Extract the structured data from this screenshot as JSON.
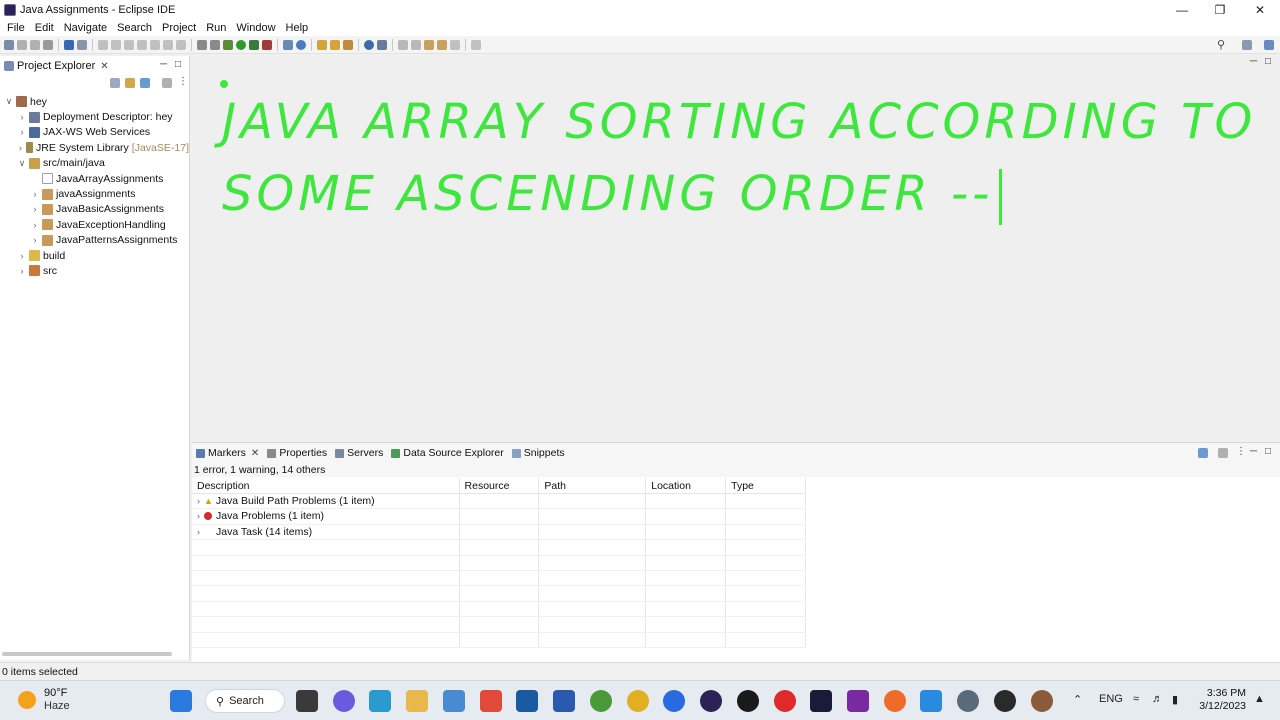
{
  "window": {
    "title": "Java Assignments - Eclipse IDE"
  },
  "menu": [
    "File",
    "Edit",
    "Navigate",
    "Search",
    "Project",
    "Run",
    "Window",
    "Help"
  ],
  "explorer": {
    "tab_title": "Project Explorer",
    "tree": [
      {
        "label": "hey",
        "indent": 0,
        "expanded": true,
        "icon": "project-icon"
      },
      {
        "label": "Deployment Descriptor: hey",
        "indent": 1,
        "expanded": false,
        "icon": "descriptor-icon"
      },
      {
        "label": "JAX-WS Web Services",
        "indent": 1,
        "expanded": false,
        "icon": "webservice-icon"
      },
      {
        "label": "JRE System Library",
        "suffix": "[JavaSE-17]",
        "indent": 1,
        "expanded": false,
        "icon": "library-icon"
      },
      {
        "label": "src/main/java",
        "indent": 1,
        "expanded": true,
        "icon": "source-folder-icon"
      },
      {
        "label": "JavaArrayAssignments",
        "indent": 2,
        "expanded": null,
        "icon": "empty-package-icon"
      },
      {
        "label": "javaAssignments",
        "indent": 2,
        "expanded": false,
        "icon": "package-icon"
      },
      {
        "label": "JavaBasicAssignments",
        "indent": 2,
        "expanded": false,
        "icon": "package-icon"
      },
      {
        "label": "JavaExceptionHandling",
        "indent": 2,
        "expanded": false,
        "icon": "package-icon"
      },
      {
        "label": "JavaPatternsAssignments",
        "indent": 2,
        "expanded": false,
        "icon": "package-icon"
      },
      {
        "label": "build",
        "indent": 1,
        "expanded": false,
        "icon": "folder-icon"
      },
      {
        "label": "src",
        "indent": 1,
        "expanded": false,
        "icon": "folder-error-icon"
      }
    ]
  },
  "editor": {
    "annotation_line1": "JAVA ARRAY SORTING ACCORDING TO",
    "annotation_line2": "SOME ASCENDING ORDER --",
    "annotation_color": "#3ee63e"
  },
  "markers": {
    "tabs": [
      "Markers",
      "Servers",
      "Data Source Explorer",
      "Snippets"
    ],
    "properties_tab": "Properties",
    "summary": "1 error, 1 warning, 14 others",
    "columns": [
      "Description",
      "Resource",
      "Path",
      "Location",
      "Type"
    ],
    "rows": [
      {
        "description": "Java Build Path Problems (1 item)",
        "severity": "warning"
      },
      {
        "description": "Java Problems (1 item)",
        "severity": "error"
      },
      {
        "description": "Java Task (14 items)",
        "severity": "none"
      }
    ]
  },
  "statusbar": {
    "text": "0 items selected"
  },
  "taskbar": {
    "weather_temp": "90°F",
    "weather_cond": "Haze",
    "search_label": "Search",
    "lang": "ENG",
    "time": "3:36 PM",
    "date": "3/12/2023"
  },
  "colors": {
    "accent": "#3ee63e",
    "error": "#d42c2c",
    "warning": "#d8a000"
  }
}
